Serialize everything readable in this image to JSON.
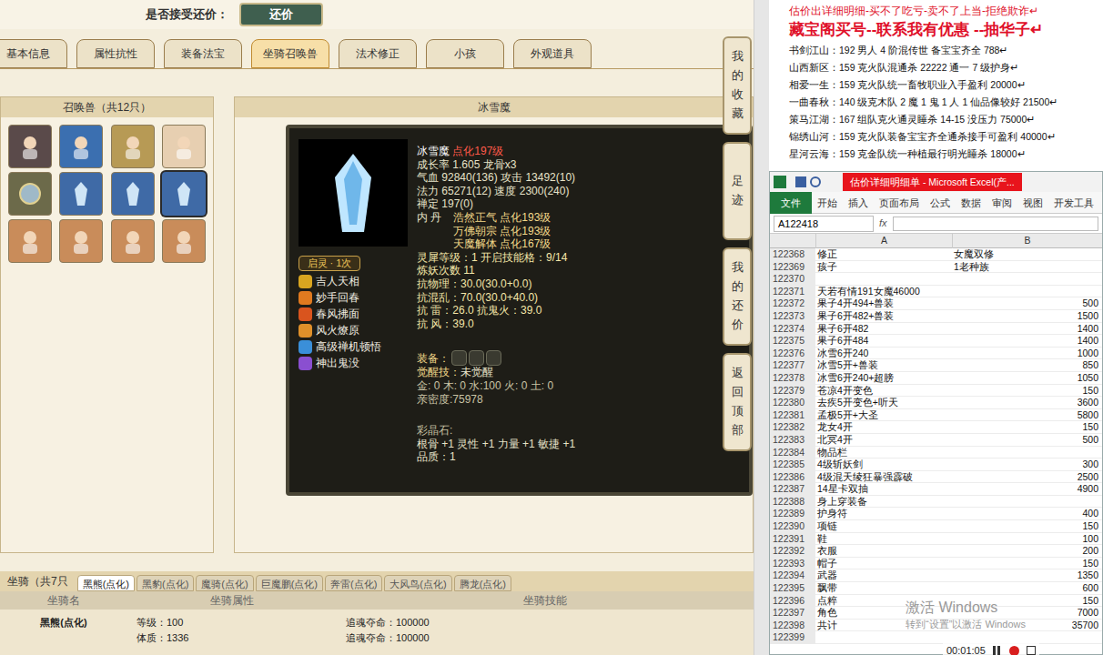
{
  "top": {
    "label": "是否接受还价：",
    "button": "还价"
  },
  "tabs": [
    {
      "label": "基本信息",
      "selected": false
    },
    {
      "label": "属性抗性",
      "selected": false
    },
    {
      "label": "装备法宝",
      "selected": false
    },
    {
      "label": "坐骑召唤兽",
      "selected": true
    },
    {
      "label": "法术修正",
      "selected": false
    },
    {
      "label": "小孩",
      "selected": false
    },
    {
      "label": "外观道具",
      "selected": false
    }
  ],
  "side_buttons": [
    "我的收藏",
    "足迹",
    "我的还价",
    "返回顶部"
  ],
  "pets_panel": {
    "title": "召唤兽（共12只）",
    "pets": [
      {
        "kind": "human",
        "selected": false
      },
      {
        "kind": "dragon",
        "selected": false
      },
      {
        "kind": "beast",
        "selected": false
      },
      {
        "kind": "cat",
        "selected": false
      },
      {
        "kind": "orb",
        "selected": false
      },
      {
        "kind": "ice",
        "selected": false
      },
      {
        "kind": "ice",
        "selected": false
      },
      {
        "kind": "ice",
        "selected": true
      },
      {
        "kind": "girl",
        "selected": false
      },
      {
        "kind": "girl",
        "selected": false
      },
      {
        "kind": "girl",
        "selected": false
      },
      {
        "kind": "girl",
        "selected": false
      }
    ]
  },
  "pet_detail": {
    "title": "冰雪魔",
    "name": "冰雪魔",
    "rank": "点化197级",
    "stats": [
      "成长率 1.605 龙骨x3",
      "气血 92840(136) 攻击 13492(10)",
      "法力 65271(12) 速度 2300(240)",
      "禅定 197(0)"
    ],
    "neidan_label": "内 丹",
    "neidan": [
      {
        "name": "浩然正气",
        "level": "点化193级"
      },
      {
        "name": "万佛朝宗",
        "level": "点化193级"
      },
      {
        "name": "天魔解体",
        "level": "点化167级"
      }
    ],
    "extra": [
      "灵犀等级：1 开启技能格：9/14",
      "炼妖次数 11",
      "抗物理：30.0(30.0+0.0)",
      "抗混乱：70.0(30.0+40.0)",
      "抗 雷：26.0 抗鬼火：39.0",
      "抗 风：39.0"
    ],
    "badge": "启灵 · 1次",
    "skills": [
      {
        "name": "吉人天相",
        "color": "#d9a520"
      },
      {
        "name": "妙手回春",
        "color": "#e07a1f"
      },
      {
        "name": "春风拂面",
        "color": "#d9541e"
      },
      {
        "name": "风火燎原",
        "color": "#e0902a"
      },
      {
        "name": "高级禅机顿悟",
        "color": "#3a8fd9"
      },
      {
        "name": "神出鬼没",
        "color": "#8a4fd0"
      }
    ],
    "equip_label": "装备：",
    "equip_slots": 3,
    "awaken_label": "觉醒技：",
    "awaken_value": "未觉醒",
    "elements": "金: 0 木: 0 水:100 火: 0 土: 0",
    "intimacy": "亲密度:75978",
    "crystal_label": "彩晶石:",
    "crystal_attrs": "根骨 +1 灵性 +1 力量 +1 敏捷 +1",
    "quality": "品质：1"
  },
  "mounts": {
    "title": "坐骑（共7只",
    "tabs": [
      {
        "label": "黑熊(点化)",
        "selected": true
      },
      {
        "label": "黑豹(点化)",
        "selected": false
      },
      {
        "label": "魔骑(点化)",
        "selected": false
      },
      {
        "label": "巨魔鹏(点化)",
        "selected": false
      },
      {
        "label": "奔雷(点化)",
        "selected": false
      },
      {
        "label": "大风鸟(点化)",
        "selected": false
      },
      {
        "label": "腾龙(点化)",
        "selected": false
      }
    ],
    "columns": [
      "坐骑名",
      "坐骑属性",
      "坐骑技能"
    ],
    "rows": [
      {
        "name": "黑熊(点化)",
        "attrs": [
          "等级：100",
          "体质：1336"
        ],
        "skills": [
          "追魂夺命：100000",
          "追魂夺命：100000"
        ]
      }
    ]
  },
  "doc": {
    "title": "估价出详细明细-买不了吃亏-卖不了上当-拒绝欺诈↵",
    "headline": "藏宝阁买号--联系我有优惠 --抽华子↵",
    "lines": [
      "书剑江山：192 男人 4 阶混传世 备宝宝齐全 788↵",
      "山西新区：159 克火队混通杀 22222 通一 7 级护身↵",
      "相爱一生：159 克火队统一畜牧职业入手盈利 20000↵",
      "一曲春秋：140 级克木队 2 魔 1 鬼 1 人 1 仙品像较好 21500↵",
      "策马江湖：167 组队克火通灵睡杀 14-15 没压力 75000↵",
      "锦绣山河：159 克火队装备宝宝齐全通杀接手可盈利 40000↵",
      "星河云海：159 克金队统一种植最行明光睡杀 18000↵"
    ]
  },
  "excel": {
    "title": "估价详细明细单 - Microsoft Excel(产...",
    "tabs": [
      {
        "label": "文件",
        "selected": true
      },
      {
        "label": "开始",
        "selected": false
      },
      {
        "label": "插入",
        "selected": false
      },
      {
        "label": "页面布局",
        "selected": false
      },
      {
        "label": "公式",
        "selected": false
      },
      {
        "label": "数据",
        "selected": false
      },
      {
        "label": "审阅",
        "selected": false
      },
      {
        "label": "视图",
        "selected": false
      },
      {
        "label": "开发工具",
        "selected": false
      }
    ],
    "name_box": "A122418",
    "fx": "fx",
    "columns": [
      "A",
      "B"
    ],
    "rows": [
      [
        "122368",
        "修正",
        "女魔双修"
      ],
      [
        "122369",
        "孩子",
        "1老种族"
      ],
      [
        "122370",
        "",
        ""
      ],
      [
        "122371",
        "天若有情191女魔46000",
        ""
      ],
      [
        "122372",
        "果子4开494+兽装",
        "500"
      ],
      [
        "122373",
        "果子6开482+兽装",
        "1500"
      ],
      [
        "122374",
        "果子6开482",
        "1400"
      ],
      [
        "122375",
        "果子6开484",
        "1400"
      ],
      [
        "122376",
        "冰雪6开240",
        "1000"
      ],
      [
        "122377",
        "冰雪5开+兽装",
        "850"
      ],
      [
        "122378",
        "冰雪6开240+超膀",
        "1050"
      ],
      [
        "122379",
        "苍凉4开变色",
        "150"
      ],
      [
        "122380",
        "去疾5开变色+听天",
        "3600"
      ],
      [
        "122381",
        "孟极5开+大圣",
        "5800"
      ],
      [
        "122382",
        "龙女4开",
        "150"
      ],
      [
        "122383",
        "北冥4开",
        "500"
      ],
      [
        "122384",
        "物品栏",
        ""
      ],
      [
        "122385",
        "4级斩妖剑",
        "300"
      ],
      [
        "122386",
        "4级混天绫狂暴强霹破",
        "2500"
      ],
      [
        "122387",
        "14星卡双抽",
        "4900"
      ],
      [
        "122388",
        "身上穿装备",
        ""
      ],
      [
        "122389",
        "护身符",
        "400"
      ],
      [
        "122390",
        "项链",
        "150"
      ],
      [
        "122391",
        "鞋",
        "100"
      ],
      [
        "122392",
        "衣服",
        "200"
      ],
      [
        "122393",
        "帽子",
        "150"
      ],
      [
        "122394",
        "武器",
        "1350"
      ],
      [
        "122395",
        "飘带",
        "600"
      ],
      [
        "122396",
        "点粹",
        "150"
      ],
      [
        "122397",
        "角色",
        "7000"
      ],
      [
        "122398",
        "共计",
        "35700"
      ],
      [
        "122399",
        "",
        ""
      ]
    ]
  },
  "watermark": {
    "line1": "激活 Windows",
    "line2": "转到“设置”以激活 Windows"
  },
  "player": {
    "time": "00:01:05"
  }
}
